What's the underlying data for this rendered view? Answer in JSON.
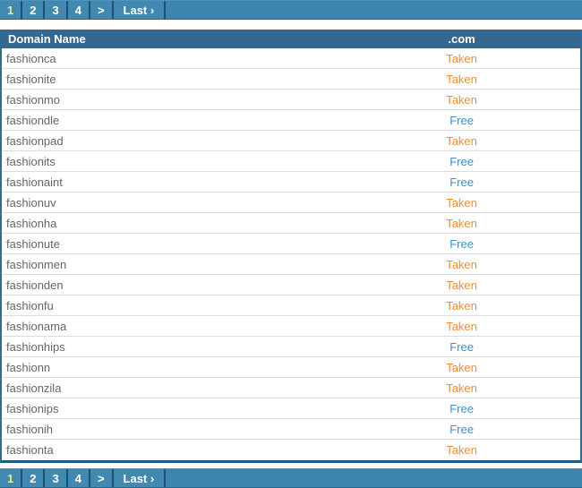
{
  "pagination": {
    "pages": [
      "1",
      "2",
      "3",
      "4"
    ],
    "current": "1",
    "next_label": ">",
    "last_label": "Last ›"
  },
  "table": {
    "columns": [
      {
        "label": "Domain Name"
      },
      {
        "label": ".com"
      }
    ],
    "rows": [
      {
        "domain": "fashionca",
        "status": "Taken"
      },
      {
        "domain": "fashionite",
        "status": "Taken"
      },
      {
        "domain": "fashionmo",
        "status": "Taken"
      },
      {
        "domain": "fashiondle",
        "status": "Free"
      },
      {
        "domain": "fashionpad",
        "status": "Taken"
      },
      {
        "domain": "fashionits",
        "status": "Free"
      },
      {
        "domain": "fashionaint",
        "status": "Free"
      },
      {
        "domain": "fashionuv",
        "status": "Taken"
      },
      {
        "domain": "fashionha",
        "status": "Taken"
      },
      {
        "domain": "fashionute",
        "status": "Free"
      },
      {
        "domain": "fashionmen",
        "status": "Taken"
      },
      {
        "domain": "fashionden",
        "status": "Taken"
      },
      {
        "domain": "fashionfu",
        "status": "Taken"
      },
      {
        "domain": "fashionama",
        "status": "Taken"
      },
      {
        "domain": "fashionhips",
        "status": "Free"
      },
      {
        "domain": "fashionn",
        "status": "Taken"
      },
      {
        "domain": "fashionzila",
        "status": "Taken"
      },
      {
        "domain": "fashionips",
        "status": "Free"
      },
      {
        "domain": "fashionih",
        "status": "Free"
      },
      {
        "domain": "fashionta",
        "status": "Taken"
      }
    ]
  },
  "colors": {
    "bar_background": "#3d85ae",
    "header_background": "#36688f",
    "current_page_text": "#e9ed8a",
    "taken": "#ef8e31",
    "free": "#3a8fd0"
  }
}
